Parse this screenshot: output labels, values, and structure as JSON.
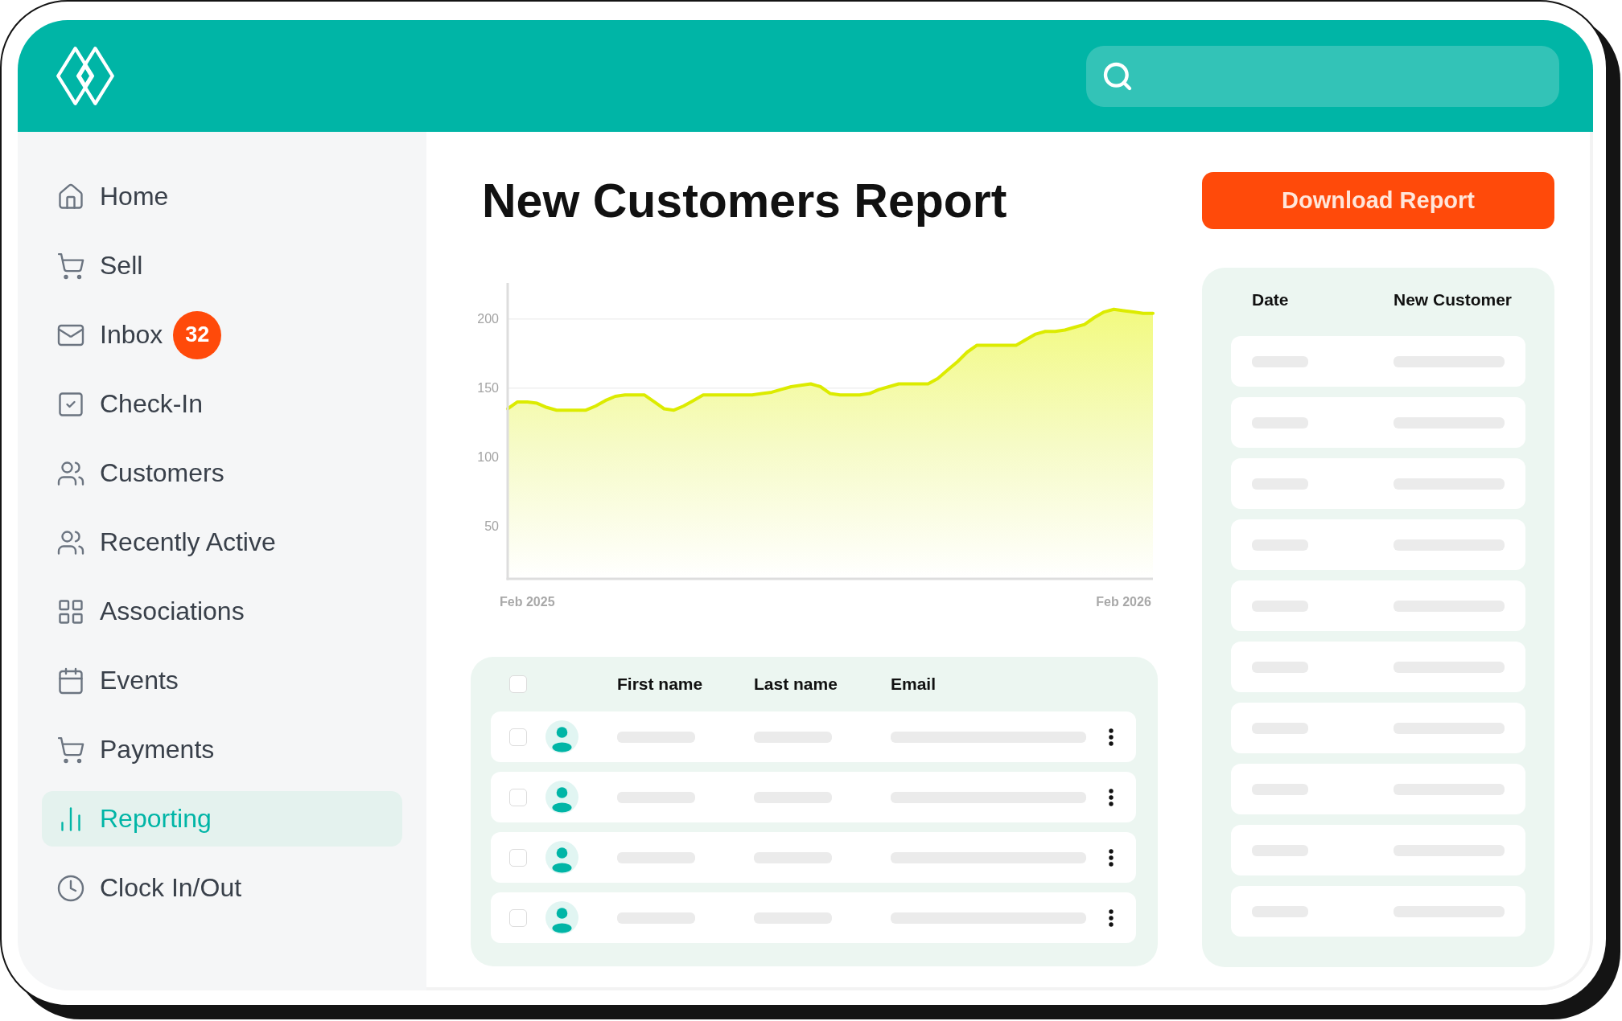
{
  "sidebar": {
    "items": [
      {
        "label": "Home",
        "selected": false
      },
      {
        "label": "Sell",
        "selected": false
      },
      {
        "label": "Inbox",
        "selected": false,
        "badge": "32"
      },
      {
        "label": "Check-In",
        "selected": false
      },
      {
        "label": "Customers",
        "selected": false
      },
      {
        "label": "Recently Active",
        "selected": false
      },
      {
        "label": "Associations",
        "selected": false
      },
      {
        "label": "Events",
        "selected": false
      },
      {
        "label": "Payments",
        "selected": false
      },
      {
        "label": "Reporting",
        "selected": true
      },
      {
        "label": "Clock In/Out",
        "selected": false
      }
    ]
  },
  "report": {
    "title": "New Customers Report",
    "download_button": "Download Report",
    "chart": {
      "chart_data": {
        "type": "area",
        "categories": [
          null,
          null,
          "Feb 2025",
          null,
          null,
          null,
          null,
          null,
          null,
          null,
          null,
          null,
          null,
          null,
          null,
          null,
          null,
          null,
          null,
          null,
          null,
          null,
          null,
          null,
          null,
          null,
          null,
          null,
          null,
          null,
          null,
          null,
          null,
          null,
          null,
          null,
          null,
          null,
          null,
          null,
          null,
          null,
          null,
          null,
          null,
          null,
          null,
          null,
          null,
          null,
          null,
          null,
          null,
          null,
          null,
          null,
          null,
          null,
          null,
          null,
          null,
          null,
          null,
          "Feb 2026",
          null,
          null,
          null
        ],
        "series": [
          {
            "color": "#dceb00",
            "values": [
              135,
              140,
              140,
              139,
              136,
              134,
              134,
              134,
              134,
              137,
              141,
              144,
              145,
              145,
              145,
              140,
              135,
              134,
              137,
              141,
              145,
              145,
              145,
              145,
              145,
              145,
              146,
              147,
              149,
              151,
              152,
              153,
              151,
              146,
              145,
              145,
              145,
              146,
              149,
              151,
              153,
              153,
              153,
              153,
              157,
              163,
              169,
              176,
              181,
              181,
              181,
              181,
              181,
              185,
              189,
              191,
              191,
              192,
              194,
              196,
              201,
              205,
              207,
              206,
              205,
              204,
              204
            ]
          }
        ],
        "ylim": [
          12,
          226
        ],
        "yticks": [
          50,
          100,
          150,
          200
        ]
      }
    },
    "customers_table": {
      "select_all_checked": false,
      "columns": [
        "First name",
        "Last name",
        "Email"
      ],
      "rows": [
        {
          "checked": false
        },
        {
          "checked": false
        },
        {
          "checked": false
        },
        {
          "checked": false
        }
      ]
    },
    "daily_table": {
      "columns": [
        "Date",
        "New Customer"
      ]
    }
  }
}
